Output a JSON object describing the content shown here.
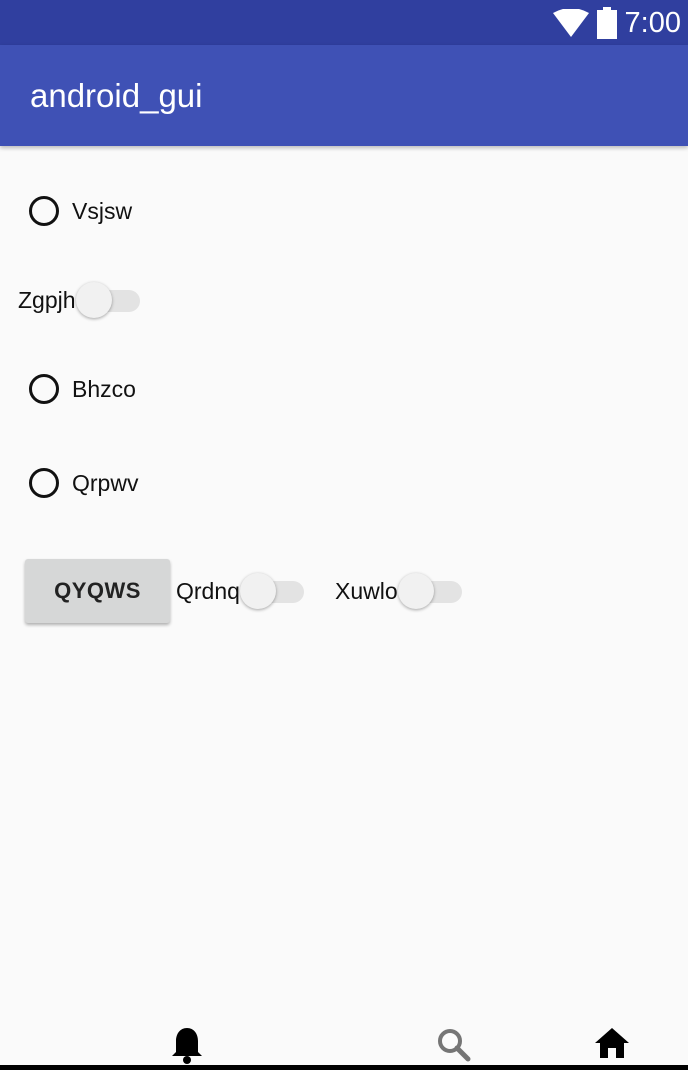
{
  "status_bar": {
    "time": "7:00",
    "wifi_icon": "wifi-icon",
    "battery_icon": "battery-icon"
  },
  "app_bar": {
    "title": "android_gui"
  },
  "controls": {
    "radio_vsjsw": "Vsjsw",
    "switch_zgpjh": "Zgpjh",
    "radio_bhzco": "Bhzco",
    "radio_qrpwv": "Qrpwv",
    "button_qyqws": "QYQWS",
    "switch_qrdnq": "Qrdnq",
    "switch_xuwlo": "Xuwlo"
  },
  "bottom_nav": {
    "items": [
      {
        "icon": "bell-icon"
      },
      {
        "icon": "search-icon"
      },
      {
        "icon": "home-icon"
      }
    ]
  },
  "colors": {
    "status_bar": "#303f9f",
    "app_bar": "#3f51b5",
    "background": "#fafafa",
    "button": "#d6d7d7"
  }
}
